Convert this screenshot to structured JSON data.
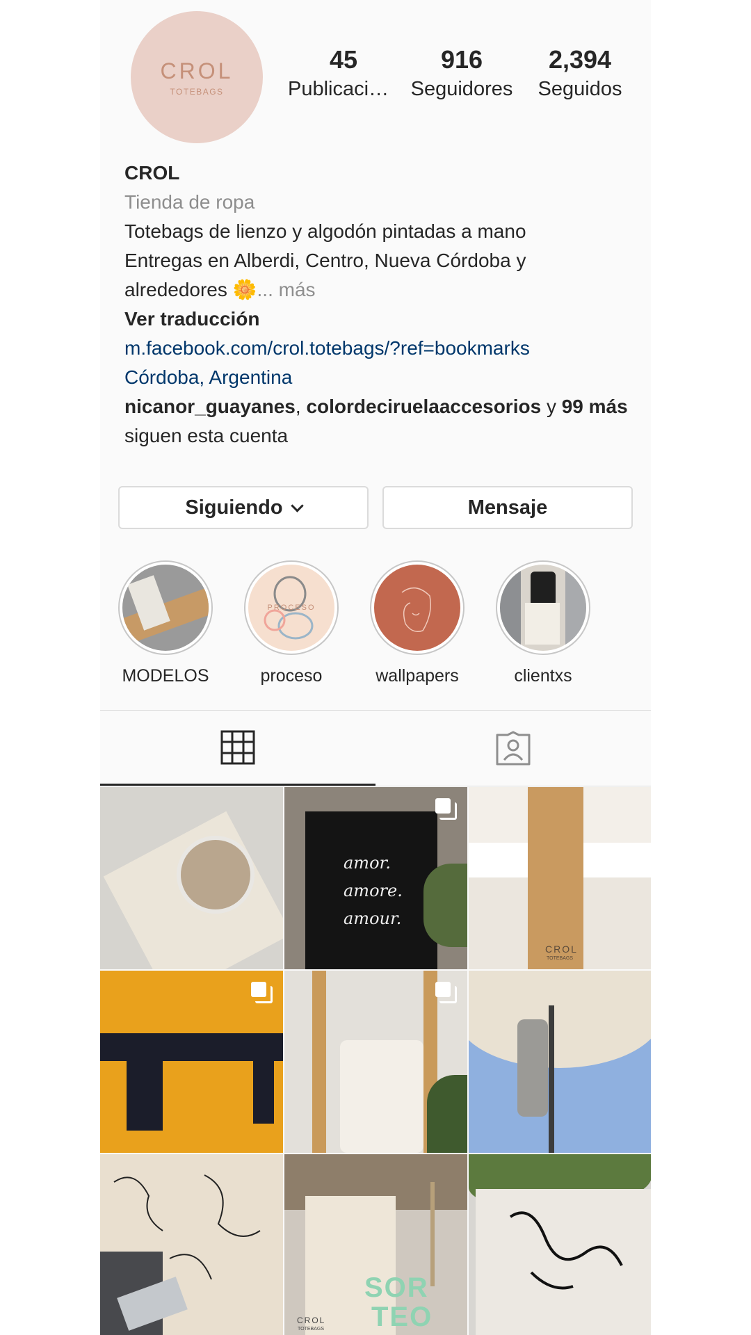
{
  "profile": {
    "avatar_brand": "CROL",
    "avatar_sub": "TOTEBAGS",
    "stats": [
      {
        "value": "45",
        "label": "Publicaciones"
      },
      {
        "value": "916",
        "label": "Seguidores"
      },
      {
        "value": "2,394",
        "label": "Seguidos"
      }
    ],
    "name": "CROL",
    "category": "Tienda de ropa",
    "bio_line1": "Totebags de lienzo y algodón pintadas a mano",
    "bio_line2": "Entregas en Alberdi, Centro, Nueva Córdoba y",
    "bio_line3": "alrededores",
    "bio_emoji": "🌼",
    "more": "... más",
    "see_translation": "Ver traducción",
    "website": "m.facebook.com/crol.totebags/?ref=bookmarks",
    "location": "Córdoba, Argentina",
    "followed_by_1": "nicanor_guayanes",
    "followed_by_sep": ", ",
    "followed_by_2": "colordeciruelaaccesorios",
    "followed_by_and": " y ",
    "followed_by_more": "99 más",
    "followed_by_suffix": " siguen esta cuenta"
  },
  "buttons": {
    "following": "Siguiendo",
    "message": "Mensaje"
  },
  "highlights": [
    {
      "label": "MODELOS"
    },
    {
      "label": "proceso",
      "cover_text": "PROCESO"
    },
    {
      "label": "wallpapers"
    },
    {
      "label": "clientxs"
    }
  ],
  "tabs": {
    "grid_icon": "grid-icon",
    "tagged_icon": "tagged-person-icon"
  },
  "posts": [
    {
      "multi": false
    },
    {
      "multi": true,
      "text_lines": [
        "amor.",
        "amore.",
        "amour."
      ]
    },
    {
      "multi": false,
      "brand": "CROL",
      "brand_sub": "TOTEBAGS"
    },
    {
      "multi": true
    },
    {
      "multi": true
    },
    {
      "multi": false
    },
    {
      "multi": false
    },
    {
      "multi": false,
      "overlay_1": "SOR",
      "overlay_2": "TEO",
      "brand": "CROL",
      "brand_sub": "TOTEBAGS"
    },
    {
      "multi": false
    }
  ]
}
